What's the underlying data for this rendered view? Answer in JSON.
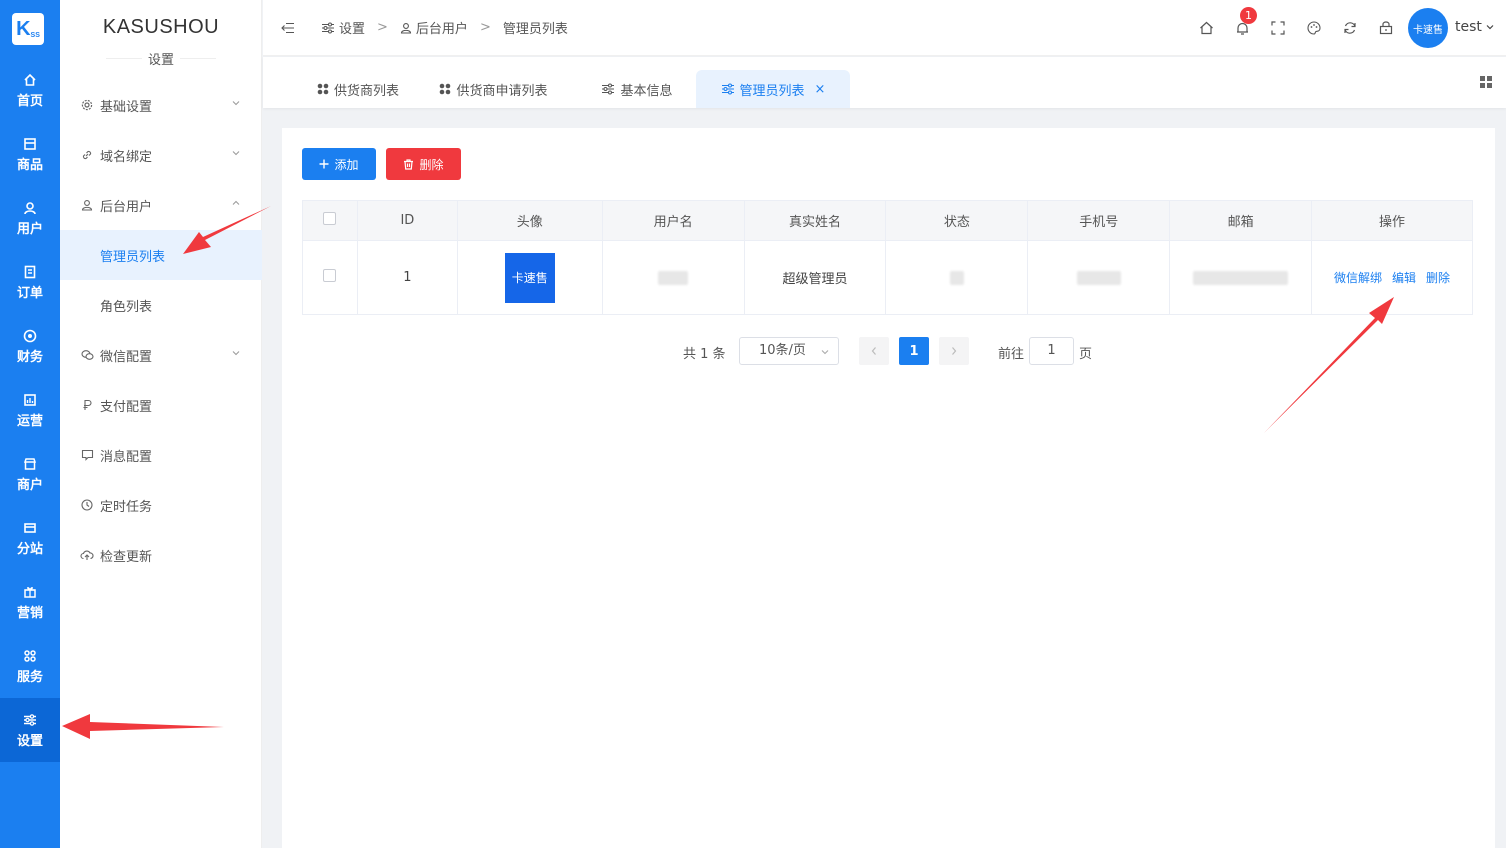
{
  "rail": {
    "logo": "K",
    "logo_sub": "SS",
    "items": [
      {
        "label": "首页",
        "icon": "home-icon"
      },
      {
        "label": "商品",
        "icon": "goods-icon"
      },
      {
        "label": "用户",
        "icon": "user-icon"
      },
      {
        "label": "订单",
        "icon": "order-icon"
      },
      {
        "label": "财务",
        "icon": "finance-icon"
      },
      {
        "label": "运营",
        "icon": "operation-icon"
      },
      {
        "label": "商户",
        "icon": "shop-icon"
      },
      {
        "label": "分站",
        "icon": "substation-icon"
      },
      {
        "label": "营销",
        "icon": "gift-icon"
      },
      {
        "label": "服务",
        "icon": "service-icon"
      },
      {
        "label": "设置",
        "icon": "settings-icon",
        "active": true
      }
    ]
  },
  "sidebar": {
    "brand": "KASUSHOU",
    "section": "设置",
    "items": [
      {
        "label": "基础设置",
        "icon": "gear-icon",
        "expandable": true
      },
      {
        "label": "域名绑定",
        "icon": "link-icon",
        "expandable": true
      },
      {
        "label": "后台用户",
        "icon": "user-icon",
        "expandable": true,
        "expanded": true
      },
      {
        "label": "管理员列表",
        "child": true,
        "selected": true
      },
      {
        "label": "角色列表",
        "child": true
      },
      {
        "label": "微信配置",
        "icon": "wechat-icon",
        "expandable": true
      },
      {
        "label": "支付配置",
        "icon": "pay-icon"
      },
      {
        "label": "消息配置",
        "icon": "message-icon"
      },
      {
        "label": "定时任务",
        "icon": "clock-icon"
      },
      {
        "label": "检查更新",
        "icon": "cloud-upload-icon"
      }
    ]
  },
  "header": {
    "breadcrumb": [
      "设置",
      "后台用户",
      "管理员列表"
    ],
    "notification_count": "1",
    "avatar_text": "卡速售",
    "username": "test"
  },
  "tabs": [
    {
      "label": "供货商列表",
      "icon": "apps-icon"
    },
    {
      "label": "供货商申请列表",
      "icon": "apps-icon"
    },
    {
      "label": "基本信息",
      "icon": "sliders-icon"
    },
    {
      "label": "管理员列表",
      "icon": "sliders-icon",
      "active": true,
      "close": "×"
    }
  ],
  "toolbar": {
    "add_label": "添加",
    "delete_label": "删除"
  },
  "table": {
    "columns": [
      "ID",
      "头像",
      "用户名",
      "真实姓名",
      "状态",
      "手机号",
      "邮箱",
      "操作"
    ],
    "rows": [
      {
        "id": "1",
        "avatar_text": "卡速售",
        "real_name": "超级管理员",
        "actions": [
          "微信解绑",
          "编辑",
          "删除"
        ]
      }
    ]
  },
  "pagination": {
    "total": "共 1 条",
    "page_size": "10条/页",
    "current": "1",
    "goto_label": "前往",
    "goto_value": "1",
    "page_suffix": "页"
  },
  "colors": {
    "primary": "#1b7ff0",
    "danger": "#f0393e",
    "rail": "#1b7ff0"
  }
}
